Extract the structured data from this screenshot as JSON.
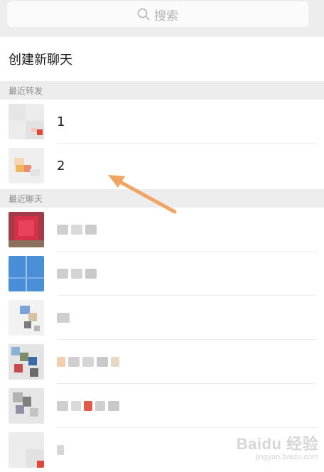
{
  "search": {
    "placeholder": "搜索",
    "icon": "search-icon"
  },
  "create_chat": {
    "label": "创建新聊天"
  },
  "sections": {
    "recent_forward": {
      "label": "最近转发"
    },
    "recent_chats": {
      "label": "最近聊天"
    }
  },
  "recent_forward_items": [
    {
      "title": "1"
    },
    {
      "title": "2"
    }
  ],
  "recent_chat_count": 6,
  "annotation": {
    "arrow_color": "#f0a563"
  },
  "watermark": {
    "brand": "Baidu 经验",
    "url": "jingyan.baidu.com"
  }
}
